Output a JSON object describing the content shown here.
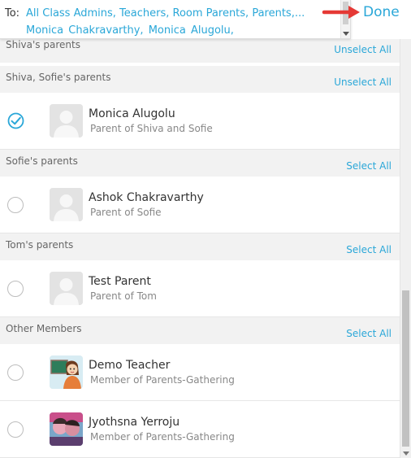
{
  "header": {
    "to_label": "To:",
    "recipients_line1": "All Class Admins, Teachers, Room Parents, Parents,...",
    "recipients_line2": "Monica Chakravarthy,   Monica Alugolu,",
    "done_label": "Done"
  },
  "groups": [
    {
      "title": "Shiva's parents",
      "action": "Unselect All"
    },
    {
      "title": "Shiva, Sofie's parents",
      "action": "Unselect All"
    },
    {
      "title": "Sofie's parents",
      "action": "Select All"
    },
    {
      "title": "Tom's parents",
      "action": "Select All"
    },
    {
      "title": "Other Members",
      "action": "Select All"
    }
  ],
  "members": [
    {
      "name": "Monica Alugolu",
      "subtitle": "Parent of Shiva and Sofie",
      "selected": true,
      "avatar": "person-placeholder-icon"
    },
    {
      "name": "Ashok Chakravarthy",
      "subtitle": "Parent of Sofie",
      "selected": false,
      "avatar": "person-placeholder-icon"
    },
    {
      "name": "Test Parent",
      "subtitle": "Parent of Tom",
      "selected": false,
      "avatar": "person-placeholder-icon"
    },
    {
      "name": "Demo Teacher",
      "subtitle": "Member of Parents-Gathering",
      "selected": false,
      "avatar": "teacher-avatar"
    },
    {
      "name": "Jyothsna Yerroju",
      "subtitle": "Member of Parents-Gathering",
      "selected": false,
      "avatar": "photo-avatar"
    }
  ],
  "colors": {
    "accent": "#2aa7d8",
    "arrow": "#e53935",
    "group_bg": "#f2f2f2"
  }
}
